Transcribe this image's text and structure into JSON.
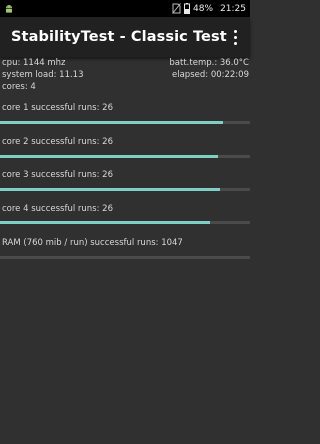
{
  "status_bar": {
    "battery_text": "48%",
    "time": "21:25",
    "icons": [
      "android-icon",
      "no-sim-icon",
      "battery-icon"
    ]
  },
  "toolbar": {
    "title": "StabilityTest - Classic Test",
    "menu_icon": "overflow-menu-icon"
  },
  "stats": {
    "cpu": "cpu: 1144 mhz",
    "batt_temp": "batt.temp.: 36.0°C",
    "system_load": "system load: 11.13",
    "elapsed": "elapsed: 00:22:09",
    "cores": "cores: 4"
  },
  "cores": [
    {
      "label": "core 1 successful runs: 26",
      "progress": 0.89
    },
    {
      "label": "core 2 successful runs: 26",
      "progress": 0.87
    },
    {
      "label": "core 3 successful runs: 26",
      "progress": 0.88
    },
    {
      "label": "core 4 successful runs: 26",
      "progress": 0.84
    }
  ],
  "ram": {
    "label": "RAM (760 mib / run) successful runs: 1047",
    "progress": 0.0
  },
  "colors": {
    "background": "#303030",
    "toolbar": "#212121",
    "progress_fill": "#7ecfc4",
    "progress_track": "#4a4a4a"
  }
}
